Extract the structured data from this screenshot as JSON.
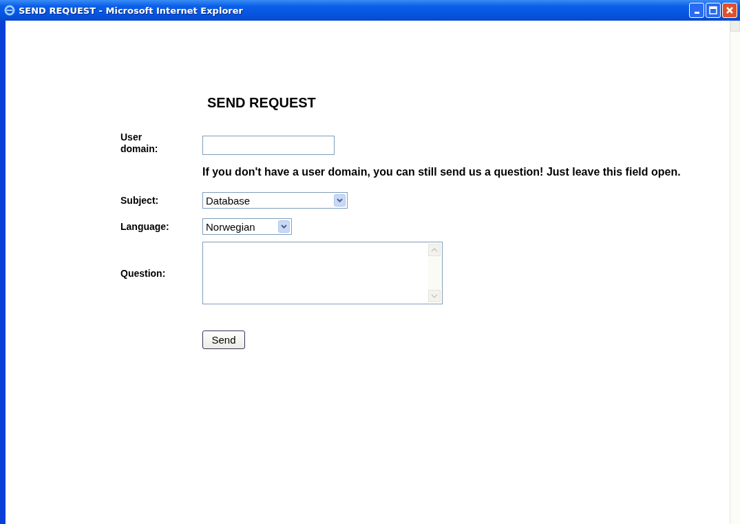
{
  "window": {
    "title": "SEND REQUEST - Microsoft Internet Explorer"
  },
  "heading": "SEND REQUEST",
  "form": {
    "user_domain": {
      "label": "User domain:"
    },
    "hint": "If you don't have a user domain, you can still send us a question! Just leave this field open.",
    "subject": {
      "label": "Subject:",
      "value": "Database"
    },
    "language": {
      "label": "Language:",
      "value": "Norwegian"
    },
    "question": {
      "label": "Question:"
    },
    "send_button": "Send"
  }
}
